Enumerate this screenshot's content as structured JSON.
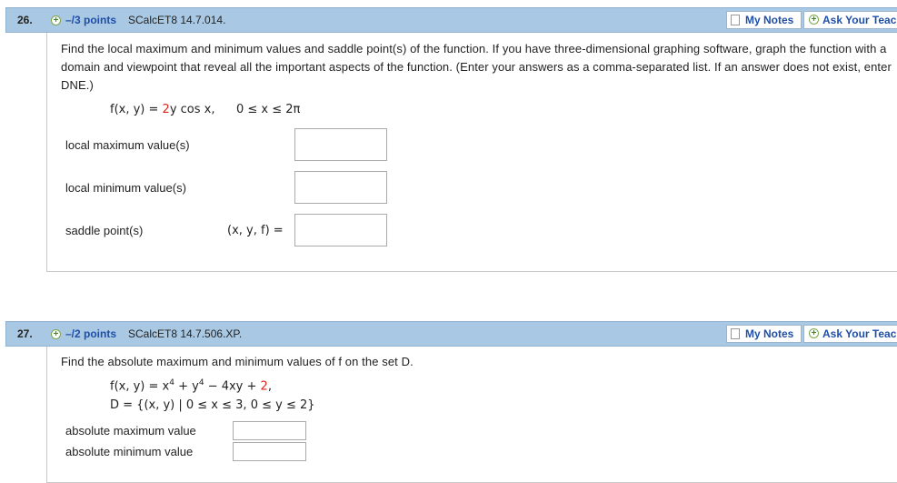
{
  "q26": {
    "number": "26.",
    "points": "–/3 points",
    "source": "SCalcET8 14.7.014.",
    "my_notes": "My Notes",
    "ask_teacher": "Ask Your Teacher",
    "instructions": "Find the local maximum and minimum values and saddle point(s) of the function. If you have three-dimensional graphing software, graph the function with a domain and viewpoint that reveal all the important aspects of the function. (Enter your answers as a comma-separated list. If an answer does not exist, enter DNE.)",
    "function_lhs": "f(x, y) = ",
    "function_coef": "2",
    "function_rhs": "y cos x,",
    "domain": "0 ≤ x ≤ 2π",
    "local_max_label": "local maximum value(s)",
    "local_min_label": "local minimum value(s)",
    "saddle_label": "saddle point(s)",
    "saddle_prefix": "(x, y, f)  =",
    "local_max_value": "",
    "local_min_value": "",
    "saddle_value": ""
  },
  "q27": {
    "number": "27.",
    "points": "–/2 points",
    "source": "SCalcET8 14.7.506.XP.",
    "my_notes": "My Notes",
    "ask_teacher": "Ask Your Teacher",
    "instructions": "Find the absolute maximum and minimum values of f on the set D.",
    "function_lhs": "f(x, y) = x",
    "exp1": "4",
    "function_mid": " + y",
    "exp2": "4",
    "function_rest": " − 4xy + ",
    "function_const": "2",
    "function_end": ",",
    "set_def": "D = {(x, y) | 0 ≤ x ≤ 3, 0 ≤ y ≤ 2}",
    "abs_max_label": "absolute maximum value",
    "abs_min_label": "absolute minimum value",
    "abs_max_value": "",
    "abs_min_value": ""
  }
}
